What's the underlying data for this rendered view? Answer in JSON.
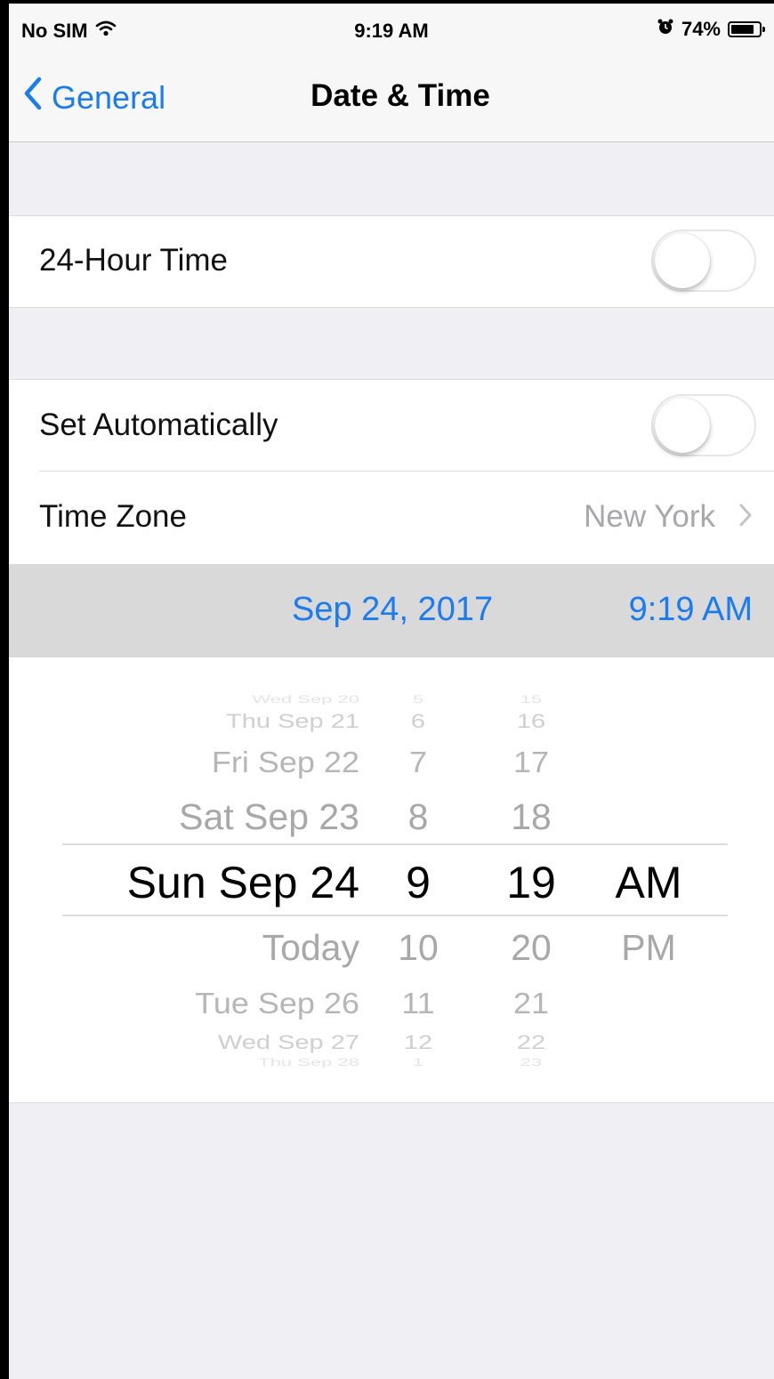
{
  "status_bar": {
    "carrier": "No SIM",
    "time": "9:19 AM",
    "battery": "74%",
    "icons": [
      "wifi-icon",
      "alarm-icon",
      "battery-icon"
    ]
  },
  "nav": {
    "back_label": "General",
    "title": "Date & Time"
  },
  "settings": {
    "hour24_label": "24-Hour Time",
    "hour24_on": false,
    "set_auto_label": "Set Automatically",
    "set_auto_on": false,
    "timezone_label": "Time Zone",
    "timezone_value": "New York"
  },
  "selected": {
    "date": "Sep 24, 2017",
    "time": "9:19 AM"
  },
  "picker": {
    "days": [
      "Wed Sep 20",
      "Thu Sep 21",
      "Fri Sep 22",
      "Sat Sep 23",
      "Sun Sep 24",
      "Today",
      "Tue Sep 26",
      "Wed Sep 27",
      "Thu Sep 28"
    ],
    "hours": [
      "5",
      "6",
      "7",
      "8",
      "9",
      "10",
      "11",
      "12",
      "1"
    ],
    "minutes": [
      "15",
      "16",
      "17",
      "18",
      "19",
      "20",
      "21",
      "22",
      "23"
    ],
    "ampm": [
      "AM",
      "PM"
    ],
    "selected_index": 4
  },
  "colors": {
    "accent": "#1a7cf0",
    "background": "#efeff4",
    "highlight_bar": "#d9d9d9"
  }
}
